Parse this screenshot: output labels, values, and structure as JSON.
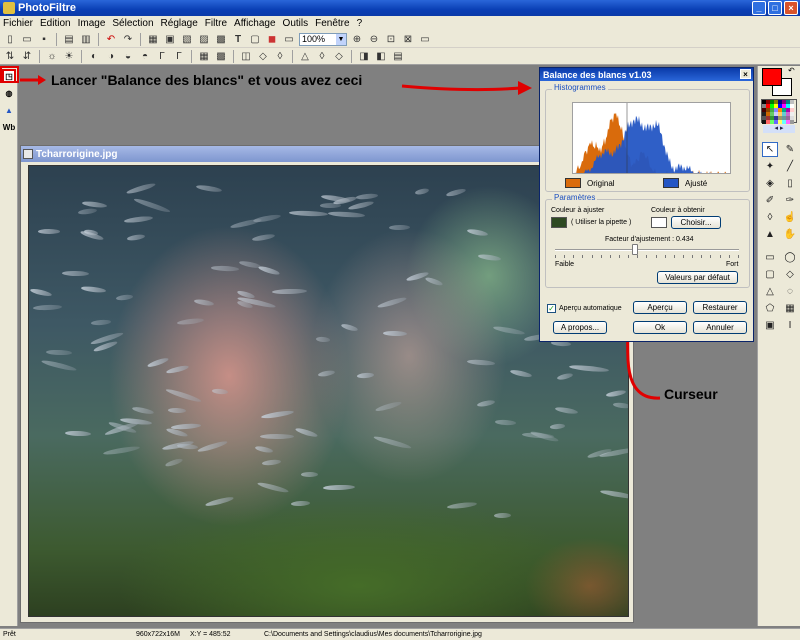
{
  "window": {
    "title": "PhotoFiltre"
  },
  "menu": [
    "Fichier",
    "Edition",
    "Image",
    "Sélection",
    "Réglage",
    "Filtre",
    "Affichage",
    "Outils",
    "Fenêtre",
    "?"
  ],
  "toolbar": {
    "zoom": "100%"
  },
  "left_palette": {
    "wb_label": "Wb"
  },
  "annotations": {
    "main": "Lancer  \"Balance des blancs\" et vous avez ceci",
    "cursor": "Curseur"
  },
  "image_window": {
    "title": "Tcharrorigine.jpg"
  },
  "dialog": {
    "title": "Balance des blancs v1.03",
    "histogram_group": "Histogrammes",
    "legend_original": "Original",
    "legend_adjusted": "Ajusté",
    "params_group": "Paramètres",
    "color_to_adjust_label": "Couleur à ajuster",
    "use_eyedropper": "( Utiliser la pipette )",
    "color_target_label": "Couleur à obtenir",
    "choose_button": "Choisir...",
    "factor_label": "Facteur d'ajustement : 0.434",
    "factor_value": 0.434,
    "weak_label": "Faible",
    "strong_label": "Fort",
    "defaults_button": "Valeurs par défaut",
    "auto_preview_label": "Aperçu automatique",
    "auto_preview_checked": true,
    "preview_button": "Aperçu",
    "restore_button": "Restaurer",
    "about_button": "A propos...",
    "ok_button": "Ok",
    "cancel_button": "Annuler",
    "colors": {
      "original": "#d96b0c",
      "adjusted": "#2456c4",
      "adjust_swatch": "#2e4a22",
      "target_swatch": "#ffffff"
    }
  },
  "status": {
    "state": "Prêt",
    "dimensions": "960x722x16M",
    "coords": "X:Y = 485:52",
    "path": "C:\\Documents and Settings\\claudius\\Mes documents\\Tcharrorigine.jpg"
  },
  "colors": {
    "foreground": "#ff0000",
    "background": "#ffffff",
    "annotation_red": "#e00000"
  }
}
